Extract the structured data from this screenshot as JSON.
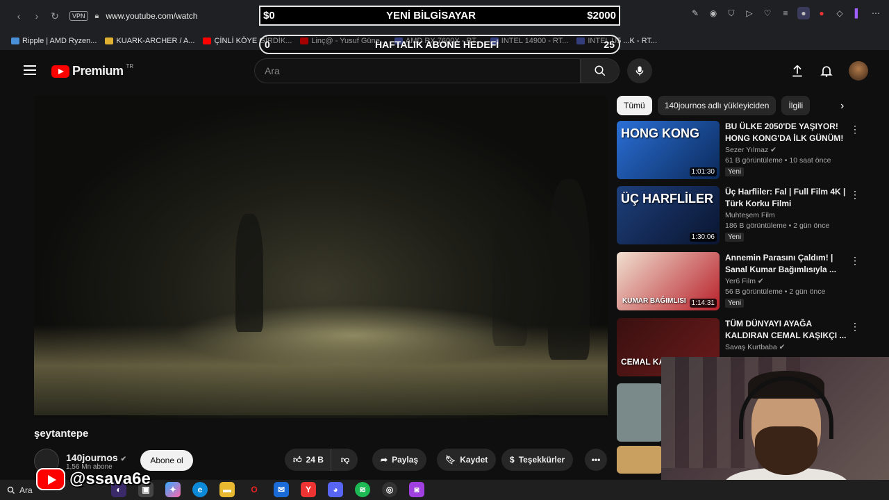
{
  "browser": {
    "url": "www.youtube.com/watch",
    "vpn_label": "VPN",
    "bookmarks": [
      {
        "label": "Ripple | AMD Ryzen...",
        "color": "#4a90d9"
      },
      {
        "label": "KUARK-ARCHER / A...",
        "color": "#e0b030"
      },
      {
        "label": "ÇİNLİ KÖYE GİRDİK...",
        "color": "#ff0000"
      },
      {
        "label": "Linç@ - Yusuf Güne...",
        "color": "#ff0000"
      },
      {
        "label": "AMD RX 7600X - RT...",
        "color": "#5060c0"
      },
      {
        "label": "INTEL 14900 - RT...",
        "color": "#5060c0"
      },
      {
        "label": "INTEL U5 ...K - RT...",
        "color": "#5060c0"
      }
    ]
  },
  "overlay": {
    "goal_left": "$0",
    "goal_title": "YENİ BİLGİSAYAR",
    "goal_right": "$2000",
    "sub_left": "0",
    "sub_title": "HAFTALIK ABONE HEDEFİ",
    "sub_right": "25"
  },
  "header": {
    "logo_text": "Premium",
    "logo_country": "TR",
    "search_placeholder": "Ara"
  },
  "video": {
    "title": "şeytantepe",
    "channel": "140journos",
    "subscribers": "1,56 Mn abone",
    "subscribe_label": "Abone ol",
    "likes": "24 B",
    "share_label": "Paylaş",
    "save_label": "Kaydet",
    "thanks_label": "Teşekkürler"
  },
  "chips": [
    "Tümü",
    "140journos adlı yükleyiciden",
    "İlgili"
  ],
  "recommendations": [
    {
      "title": "BU ÜLKE 2050'DE YAŞIYOR! HONG KONG'DA İLK GÜNÜM!",
      "channel": "Sezer Yılmaz",
      "verified": true,
      "meta": "61 B görüntüleme • 10 saat önce",
      "badge": "Yeni",
      "duration": "1:01:30",
      "thumb_text": "HONG KONG",
      "thumb_color": "#2a6fd6"
    },
    {
      "title": "Üç Harfliler: Fal | Full Film 4K | Türk Korku Filmi",
      "channel": "Muhteşem Film",
      "verified": false,
      "meta": "186 B görüntüleme • 2 gün önce",
      "badge": "Yeni",
      "duration": "1:30:06",
      "thumb_text": "ÜÇ HARFLİLER",
      "thumb_color": "#1d3f7a"
    },
    {
      "title": "Annemin Parasını Çaldım! | Sanal Kumar Bağımlısıyla ...",
      "channel": "Yer6 Film",
      "verified": true,
      "meta": "56 B görüntüleme • 2 gün önce",
      "badge": "Yeni",
      "duration": "1:14:31",
      "thumb_text": "KUMAR BAĞIMLISI",
      "thumb_color": "#b8202a"
    },
    {
      "title": "TÜM DÜNYAYI AYAĞA KALDIRAN CEMAL KAŞIKÇI ...",
      "channel": "Savaş Kurtbaba",
      "verified": true,
      "meta": "",
      "badge": "",
      "duration": "",
      "thumb_text": "CEMAL KA",
      "thumb_color": "#6a1a1a"
    }
  ],
  "streamer": {
    "handle": "@ssava6e"
  },
  "taskbar": {
    "search_label": "Ara"
  }
}
